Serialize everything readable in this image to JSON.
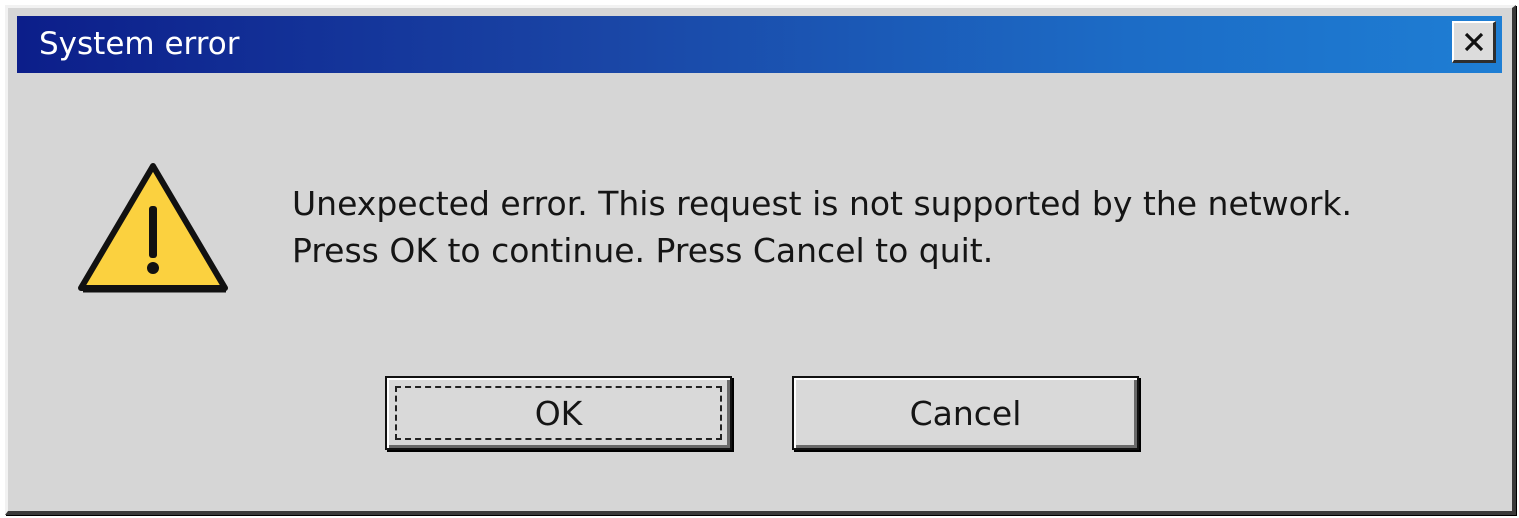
{
  "dialog": {
    "title": "System error",
    "close_icon": "close-icon",
    "warning_icon": "warning-triangle-icon",
    "message_line1": "Unexpected error. This request is not supported by the network.",
    "message_line2": "Press OK to continue. Press Cancel to quit.",
    "buttons": {
      "ok_label": "OK",
      "cancel_label": "Cancel"
    },
    "colors": {
      "titlebar_start": "#0c1e8a",
      "titlebar_end": "#1e7ed4",
      "body": "#d6d6d6",
      "warning_fill": "#fbd13f"
    }
  }
}
